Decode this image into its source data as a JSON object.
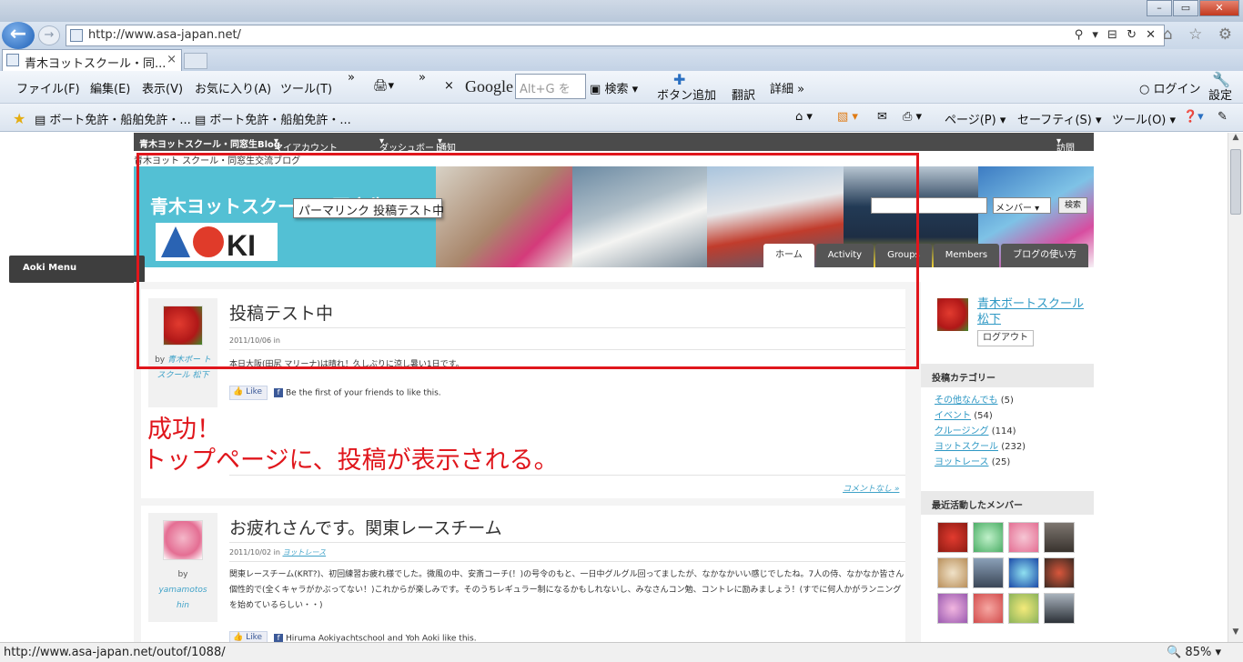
{
  "browser": {
    "url": "http://www.asa-japan.net/",
    "tab_title": "青木ヨットスクール・同...",
    "tab_close": "×",
    "addr_icons": "⚲ ▾ ⊟ ↻ ✕",
    "right_icons": "⌂ ☆ ⚙"
  },
  "menubar": {
    "file": "ファイル(F)",
    "edit": "編集(E)",
    "view": "表示(V)",
    "favorites": "お気に入り(A)",
    "tools": "ツール(T)",
    "chevron": "»",
    "close_x": "×",
    "google": "Google",
    "google_placeholder": "Alt+G を",
    "search": "検索",
    "add_button": "ボタン追加",
    "translate": "翻訳",
    "details": "詳細",
    "login": "ログイン",
    "settings": "設定"
  },
  "favbar": {
    "fav1": "ボート免許・船舶免許・...",
    "fav2": "ボート免許・船舶免許・...",
    "page": "ページ(P)",
    "safety": "セーフティ(S)",
    "tools": "ツール(O)"
  },
  "site": {
    "admin_title": "青木ヨットスクール・同窓生Blog",
    "my_account": "マイアカウント",
    "dashboard": "ダッシュボード",
    "notifications": "通知",
    "visit": "訪問",
    "subtitle": "青木ヨット スクール・同窓生交流ブログ",
    "brand": "青木ヨットスクール・同窓生Blog",
    "search_select": "メンバー",
    "search_btn": "検索",
    "aoki_menu": "Aoki Menu"
  },
  "nav": {
    "home": "ホーム",
    "activity": "Activity",
    "groups": "Groups",
    "members": "Members",
    "howto": "ブログの使い方"
  },
  "posts": [
    {
      "title": "投稿テスト中",
      "date": "2011/10/06 in",
      "category": "",
      "by_prefix": "by",
      "author_line1": "青木ボー",
      "author_line2": "トスクール",
      "author_line3": "松下",
      "body": "本日大阪(田尻 マリーナ)は晴れ！久しぶりに涼し暑い1日です。",
      "like": "Like",
      "like_text": "Be the first of your friends to like this.",
      "comments": "コメントなし »"
    },
    {
      "title": "お疲れさんです。関東レースチーム",
      "date": "2011/10/02 in",
      "category": "ヨットレース",
      "by_prefix": "by",
      "author_line1": "yamamotos",
      "author_line2": "hin",
      "body": "関東レースチーム(KRT?)、初回練習お疲れ様でした。微風の中、安斎コーチ(！)の号令のもと、一日中グルグル回ってましたが、なかなかいい感じでしたね。7人の侍、なかなか皆さん個性的で(全くキャラがかぶってない！)これからが楽しみです。そのうちレギュラー制になるかもしれないし、みなさんコン勉、コントレに励みましょう！(すでに何人かがランニングを始めているらしい・・)",
      "like": "Like",
      "like_names": "Hiruma Aokiyachtschool and Yoh Aoki like this."
    }
  ],
  "tooltip": "パーマリンク 投稿テスト中",
  "annotation": {
    "line1": "成功！",
    "line2": "トップページに、投稿が表示される。"
  },
  "sidebar": {
    "user_line1": "青木ボートスクール",
    "user_line2": "松下",
    "logout": "ログアウト",
    "categories_head": "投稿カテゴリー",
    "categories": [
      {
        "name": "その他なんでも",
        "count": "(5)"
      },
      {
        "name": "イベント",
        "count": "(54)"
      },
      {
        "name": "クルージング",
        "count": "(114)"
      },
      {
        "name": "ヨットスクール",
        "count": "(232)"
      },
      {
        "name": "ヨットレース",
        "count": "(25)"
      }
    ],
    "members_head": "最近活動したメンバー"
  },
  "status": {
    "link": "http://www.asa-japan.net/outof/1088/",
    "zoom": "85%"
  },
  "colors": {
    "annotation_red": "#e0161c",
    "banner_blue": "#53c0d4",
    "link_blue": "#2e98c4"
  }
}
